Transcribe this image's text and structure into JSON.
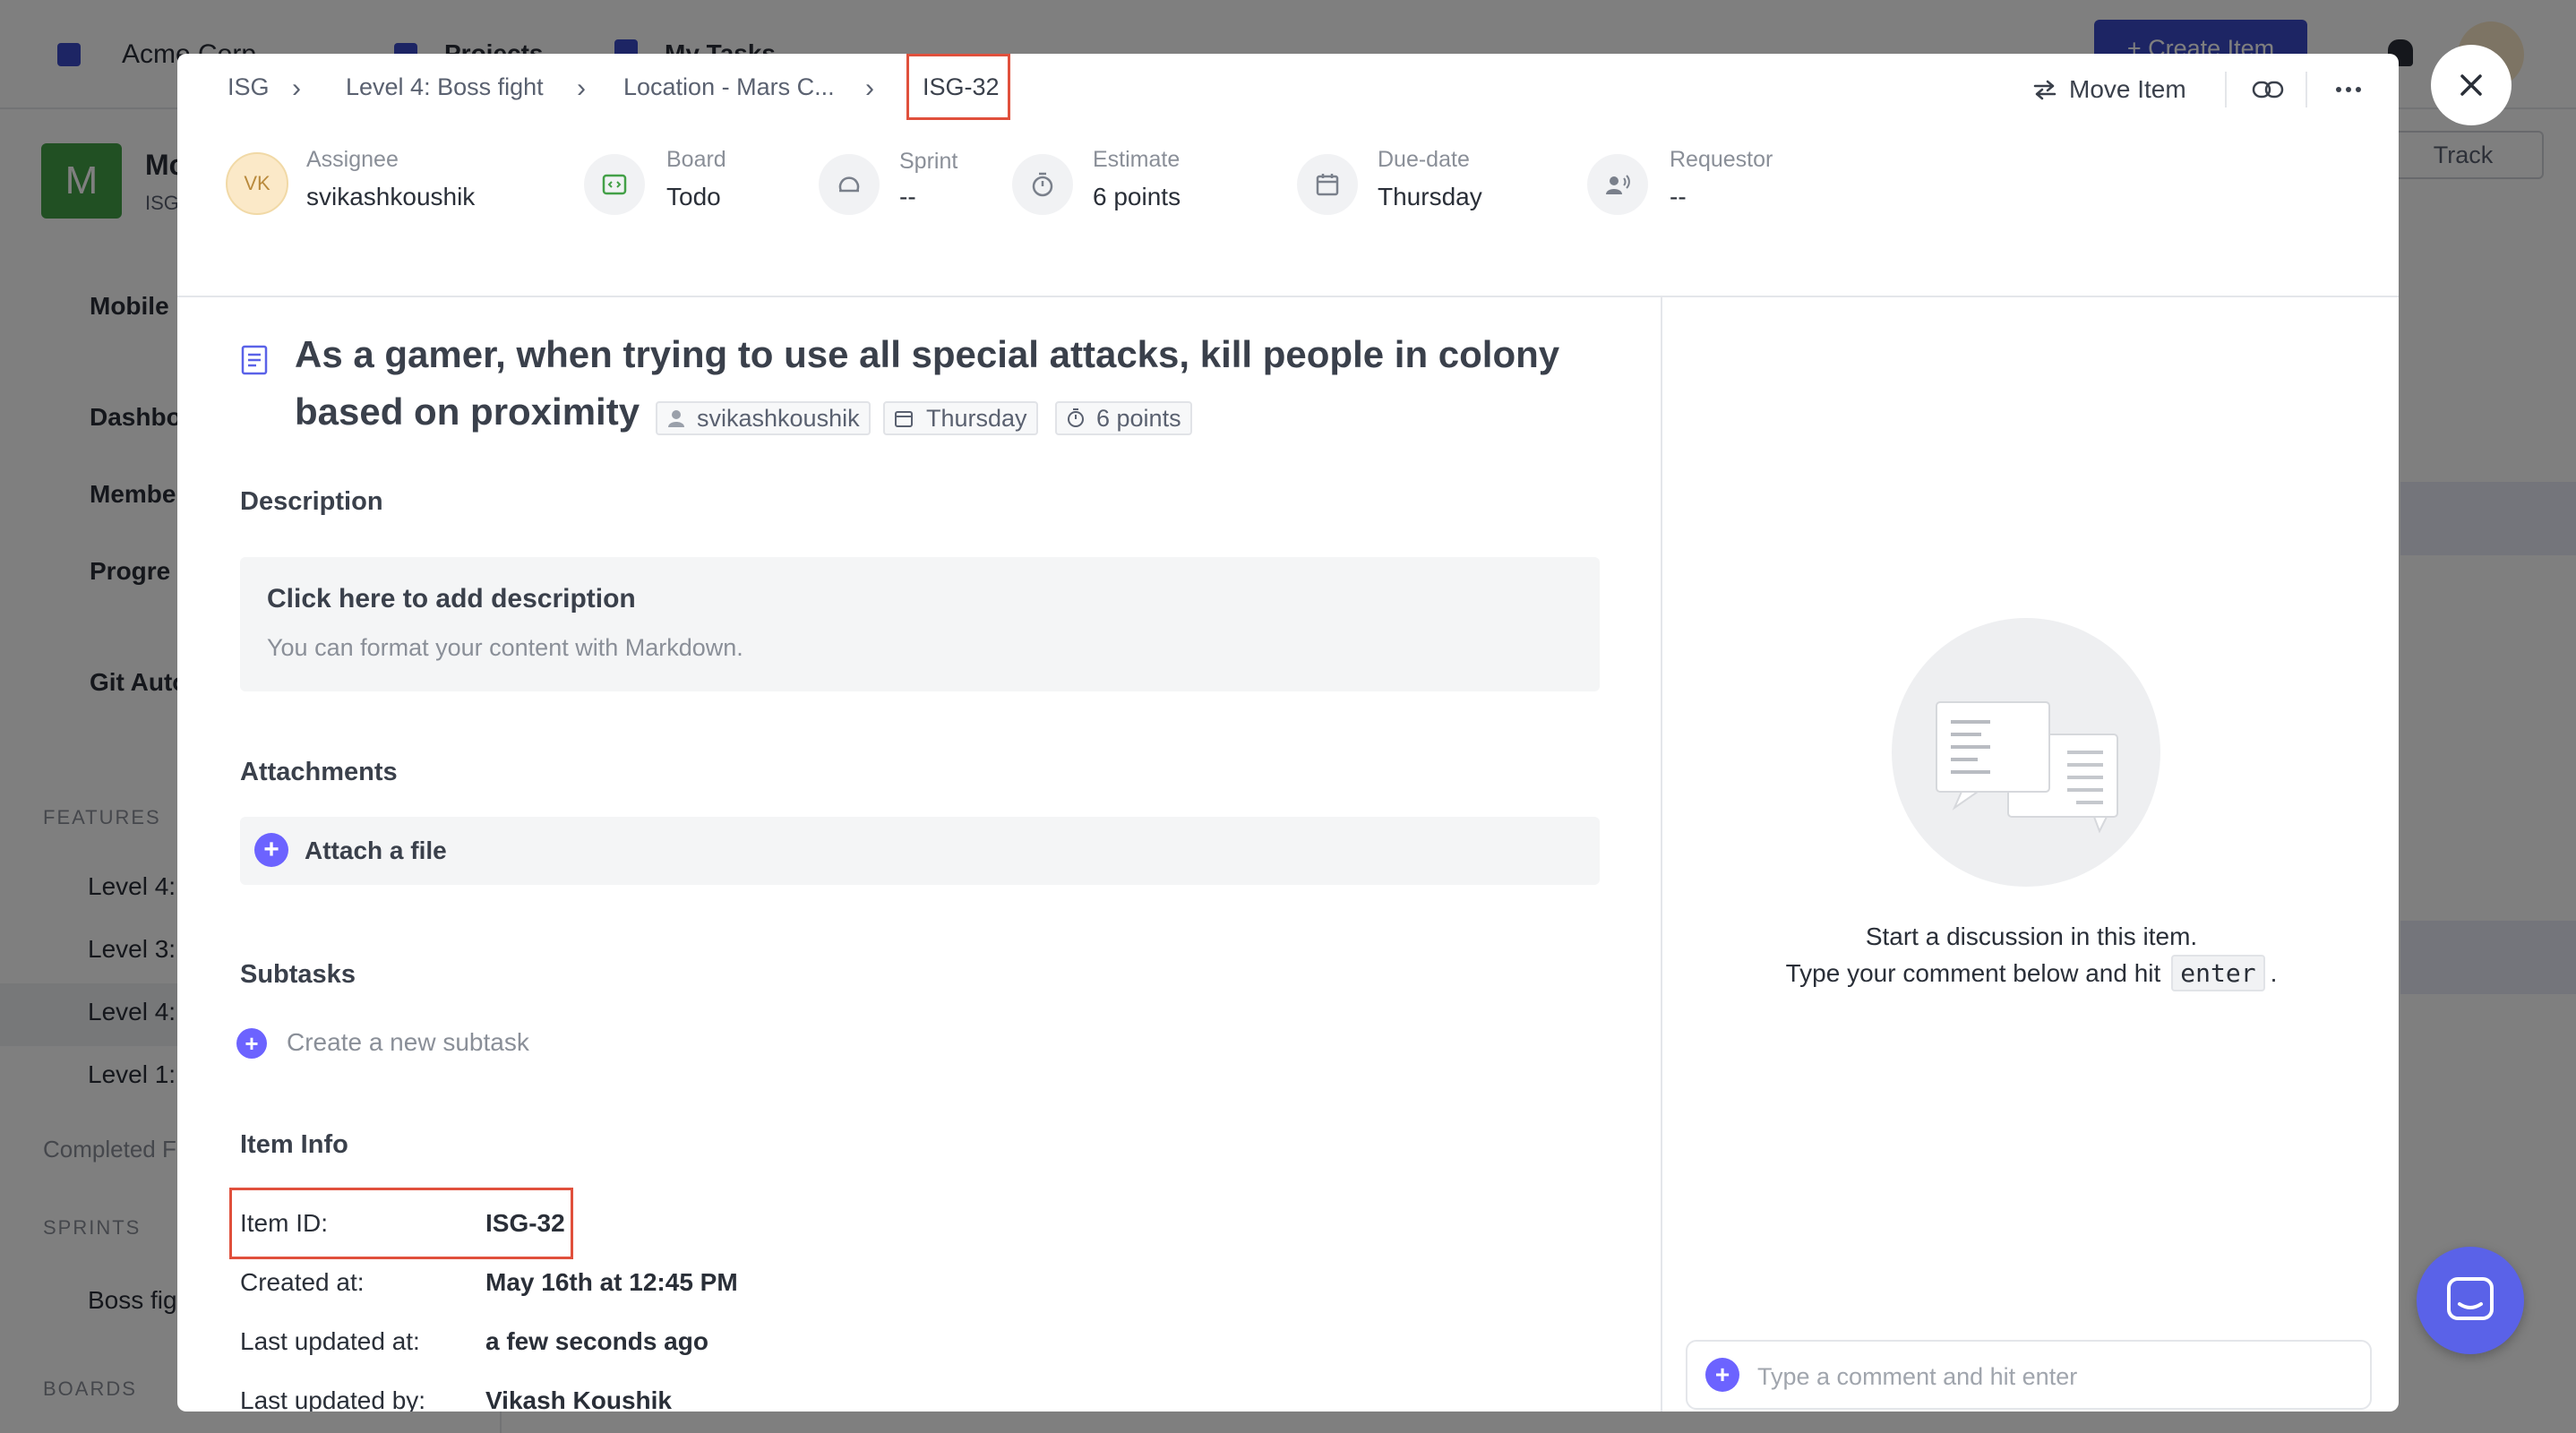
{
  "background": {
    "org_name": "Acme Corp",
    "nav_projects": "Projects",
    "nav_my_tasks": "My Tasks",
    "create_item": "+ Create Item",
    "project_initial": "M",
    "project_name": "Mc",
    "project_key": "ISG",
    "track": "Track",
    "sidebar_items": [
      "Mobile",
      "Dashbo",
      "Membe",
      "Progre",
      "Git Auto"
    ],
    "features_heading": "FEATURES",
    "feature_items": [
      "Level 4:",
      "Level 3:",
      "Level 4:",
      "Level 1:"
    ],
    "completed_label": "Completed F",
    "sprints_heading": "SPRINTS",
    "sprint_item": "Boss fig",
    "boards_heading": "BOARDS"
  },
  "breadcrumb": {
    "items": [
      "ISG",
      "Level 4: Boss fight",
      "Location - Mars C...",
      "ISG-32"
    ]
  },
  "header_actions": {
    "move_item": "Move Item"
  },
  "meta": {
    "assignee": {
      "label": "Assignee",
      "value": "svikashkoushik",
      "avatar_initials": "VK"
    },
    "board": {
      "label": "Board",
      "value": "Todo"
    },
    "sprint": {
      "label": "Sprint",
      "value": "--"
    },
    "estimate": {
      "label": "Estimate",
      "value": "6 points"
    },
    "due_date": {
      "label": "Due-date",
      "value": "Thursday"
    },
    "requestor": {
      "label": "Requestor",
      "value": "--"
    }
  },
  "item": {
    "title_line1": "As a gamer, when trying to use all special attacks, kill people in colony",
    "title_line2": "based on proximity",
    "chip_assignee": "svikashkoushik",
    "chip_due": "Thursday",
    "chip_estimate": "6 points"
  },
  "description": {
    "heading": "Description",
    "placeholder_title": "Click here to add description",
    "placeholder_hint": "You can format your content with Markdown."
  },
  "attachments": {
    "heading": "Attachments",
    "attach_label": "Attach a file"
  },
  "subtasks": {
    "heading": "Subtasks",
    "create_label": "Create a new subtask"
  },
  "item_info": {
    "heading": "Item Info",
    "rows": [
      {
        "label": "Item ID:",
        "value": "ISG-32"
      },
      {
        "label": "Created at:",
        "value": "May 16th at 12:45 PM"
      },
      {
        "label": "Last updated at:",
        "value": "a few seconds ago"
      },
      {
        "label": "Last updated by:",
        "value": "Vikash Koushik"
      }
    ]
  },
  "discussion": {
    "line1": "Start a discussion in this item.",
    "line2_prefix": "Type your comment below and hit",
    "key": "enter",
    "line2_suffix": ".",
    "comment_placeholder": "Type a comment and hit enter"
  },
  "colors": {
    "accent": "#6c63ff",
    "highlight": "#e0503c",
    "avatar_bg": "#fbe9c8"
  }
}
